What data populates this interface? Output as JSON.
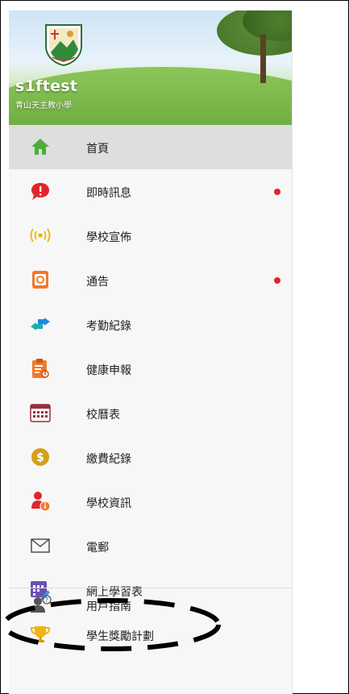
{
  "header": {
    "user_name": "s1ftest",
    "school_name": "青山天主教小學"
  },
  "menu": [
    {
      "label": "首頁",
      "icon": "home-icon",
      "active": true,
      "badge": false
    },
    {
      "label": "即時訊息",
      "icon": "message-alert-icon",
      "active": false,
      "badge": true
    },
    {
      "label": "學校宣佈",
      "icon": "broadcast-icon",
      "active": false,
      "badge": false
    },
    {
      "label": "通告",
      "icon": "notice-icon",
      "active": false,
      "badge": true
    },
    {
      "label": "考勤紀錄",
      "icon": "attendance-arrows-icon",
      "active": false,
      "badge": false
    },
    {
      "label": "健康申報",
      "icon": "health-clipboard-icon",
      "active": false,
      "badge": false
    },
    {
      "label": "校曆表",
      "icon": "calendar-icon",
      "active": false,
      "badge": false
    },
    {
      "label": "繳費紀錄",
      "icon": "dollar-coin-icon",
      "active": false,
      "badge": false
    },
    {
      "label": "學校資訊",
      "icon": "school-info-icon",
      "active": false,
      "badge": false
    },
    {
      "label": "電郵",
      "icon": "envelope-icon",
      "active": false,
      "badge": false
    },
    {
      "label": "網上學習表",
      "icon": "learning-grid-icon",
      "active": false,
      "badge": false
    },
    {
      "label": "學生獎勵計劃",
      "icon": "trophy-icon",
      "active": false,
      "badge": false
    }
  ],
  "footer_item": {
    "label": "用戶指南",
    "icon": "user-guide-icon"
  },
  "colors": {
    "accent": "#4caf3a",
    "badge": "#e2242c",
    "active_row": "#dedede"
  }
}
